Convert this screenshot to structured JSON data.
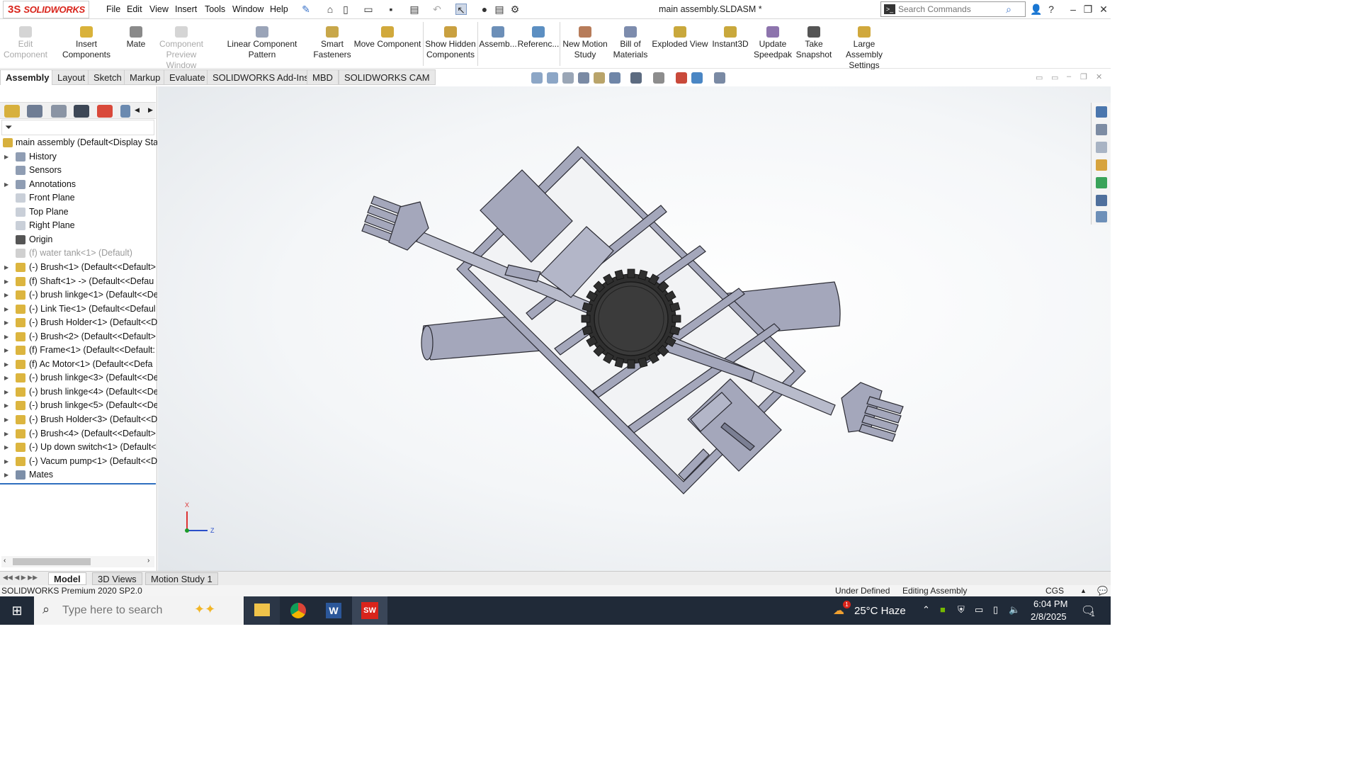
{
  "app": {
    "brand": "SOLIDWORKS",
    "brand_mark": "3S"
  },
  "menu": [
    "File",
    "Edit",
    "View",
    "Insert",
    "Tools",
    "Window",
    "Help"
  ],
  "document_title": "main assembly.SLDASM *",
  "search": {
    "placeholder": "Search Commands"
  },
  "commands": {
    "edit_component": "Edit\nComponent",
    "insert_components": "Insert Components",
    "mate": "Mate",
    "component_preview": "Component\nPreview Window",
    "linear_pattern": "Linear Component Pattern",
    "smart_fasteners": "Smart\nFasteners",
    "move_component": "Move Component",
    "show_hidden": "Show Hidden\nComponents",
    "assembly": "Assemb...",
    "reference": "Referenc...",
    "new_motion": "New Motion\nStudy",
    "bom": "Bill of\nMaterials",
    "exploded": "Exploded View",
    "instant3d": "Instant3D",
    "update_speedpak": "Update\nSpeedpak",
    "take_snapshot": "Take\nSnapshot",
    "large_assembly": "Large Assembly\nSettings"
  },
  "tabs": [
    "Assembly",
    "Layout",
    "Sketch",
    "Markup",
    "Evaluate",
    "SOLIDWORKS Add-Ins",
    "MBD",
    "SOLIDWORKS CAM"
  ],
  "tree": {
    "root": "main assembly  (Default<Display Sta",
    "items": [
      {
        "label": "History",
        "kind": "folder"
      },
      {
        "label": "Sensors",
        "kind": "folder"
      },
      {
        "label": "Annotations",
        "kind": "folder"
      },
      {
        "label": "Front Plane",
        "kind": "plane"
      },
      {
        "label": "Top Plane",
        "kind": "plane"
      },
      {
        "label": "Right Plane",
        "kind": "plane"
      },
      {
        "label": "Origin",
        "kind": "origin"
      },
      {
        "label": "(f) water tank<1> (Default)",
        "kind": "suppressed"
      },
      {
        "label": "(-) Brush<1> (Default<<Default>",
        "kind": "part"
      },
      {
        "label": "(f) Shaft<1> -> (Default<<Defau",
        "kind": "part"
      },
      {
        "label": "(-) brush linkge<1> (Default<<De",
        "kind": "part"
      },
      {
        "label": "(-) Link Tie<1> (Default<<Defaul",
        "kind": "part"
      },
      {
        "label": "(-) Brush Holder<1> (Default<<D",
        "kind": "part"
      },
      {
        "label": "(-) Brush<2> (Default<<Default>",
        "kind": "part"
      },
      {
        "label": "(f) Frame<1> (Default<<Default:",
        "kind": "part"
      },
      {
        "label": "(f) Ac Motor<1> (Default<<Defa",
        "kind": "part"
      },
      {
        "label": "(-) brush linkge<3> (Default<<De",
        "kind": "part"
      },
      {
        "label": "(-) brush linkge<4> (Default<<De",
        "kind": "part"
      },
      {
        "label": "(-) brush linkge<5> (Default<<De",
        "kind": "part"
      },
      {
        "label": "(-) Brush Holder<3> (Default<<D",
        "kind": "part"
      },
      {
        "label": "(-) Brush<4> (Default<<Default>",
        "kind": "part"
      },
      {
        "label": "(-) Up down switch<1> (Default<",
        "kind": "part"
      },
      {
        "label": "(-) Vacum pump<1> (Default<<D",
        "kind": "part"
      },
      {
        "label": "Mates",
        "kind": "mates"
      }
    ]
  },
  "triad": {
    "x": "X",
    "z": "Z"
  },
  "bottom_tabs": [
    "Model",
    "3D Views",
    "Motion Study 1"
  ],
  "status": {
    "left": "SOLIDWORKS Premium 2020 SP2.0",
    "defined": "Under Defined",
    "mode": "Editing Assembly",
    "units": "CGS"
  },
  "taskbar": {
    "search_placeholder": "Type here to search",
    "weather": "25°C  Haze",
    "time": "6:04 PM",
    "date": "2/8/2025",
    "notification_count": "1",
    "weather_badge": "1"
  },
  "colors": {
    "brand_red": "#d9241b",
    "part_fill": "#a4a7bb",
    "part_edge": "#2b2b33",
    "gear": "#3b3b3b",
    "taskbar": "#202a38"
  }
}
